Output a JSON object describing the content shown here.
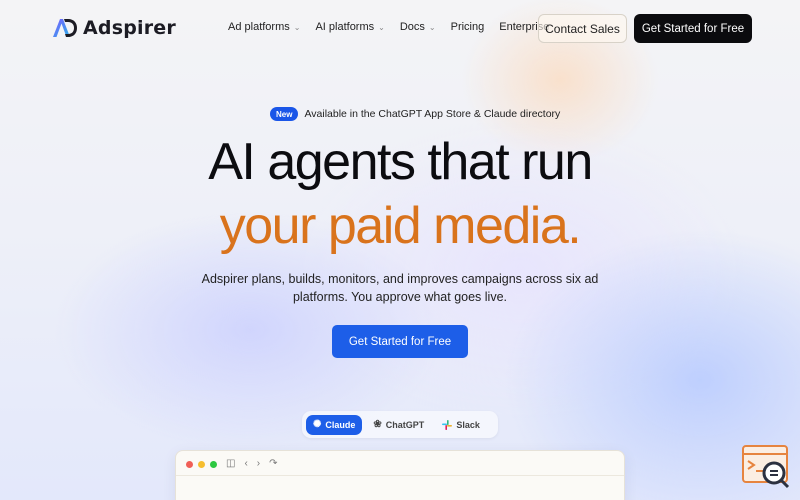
{
  "brand": {
    "name": "Adspirer"
  },
  "nav": {
    "links": [
      {
        "label": "Ad platforms",
        "dropdown": true
      },
      {
        "label": "AI platforms",
        "dropdown": true
      },
      {
        "label": "Docs",
        "dropdown": true
      },
      {
        "label": "Pricing",
        "dropdown": false
      },
      {
        "label": "Enterprise",
        "dropdown": false
      }
    ],
    "contact_label": "Contact Sales",
    "cta_label": "Get Started for Free"
  },
  "hero": {
    "badge": "New",
    "announcement": "Available in the ChatGPT App Store & Claude directory",
    "headline_line1": "AI agents that run",
    "headline_line2": "your paid media.",
    "subtitle": "Adspirer plans, builds, monitors, and improves campaigns across six ad platforms. You approve what goes live.",
    "cta_label": "Get Started for Free"
  },
  "tabs": [
    {
      "label": "Claude",
      "icon": "claude-icon",
      "active": true
    },
    {
      "label": "ChatGPT",
      "icon": "chatgpt-icon",
      "active": false
    },
    {
      "label": "Slack",
      "icon": "slack-icon",
      "active": false
    }
  ],
  "colors": {
    "accent_blue": "#1d5ee8",
    "headline_orange": "#d9731c",
    "dark_button": "#0b0b0e"
  }
}
